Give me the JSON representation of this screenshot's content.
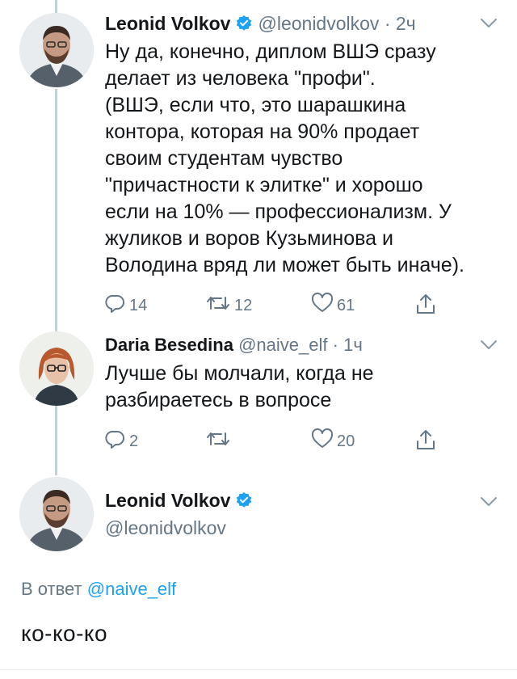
{
  "colors": {
    "accent": "#1da1f2",
    "muted": "#657786",
    "text": "#14171a",
    "thread_line": "#c4cfd6"
  },
  "tweets": [
    {
      "name": "Leonid Volkov",
      "verified": true,
      "handle": "@leonidvolkov",
      "separator": "·",
      "time": "2ч",
      "text_lines": [
        "Ну да, конечно, диплом ВШЭ сразу",
        "делает из человека \"профи\".",
        "(ВШЭ, если что, это шарашкина",
        "контора, которая на 90% продает",
        "своим студентам чувство",
        "\"причастности к элитке\" и хорошо",
        "если на 10% — профессионализм. У",
        "жуликов и воров Кузьминова и",
        "Володина вряд ли может быть иначе)."
      ],
      "replies": "14",
      "retweets": "12",
      "likes": "61"
    },
    {
      "name": "Daria Besedina",
      "verified": false,
      "handle": "@naive_elf",
      "separator": "·",
      "time": "1ч",
      "text_lines": [
        "Лучше бы молчали, когда не",
        "разбираетесь в вопросе"
      ],
      "replies": "2",
      "retweets": "",
      "likes": "20"
    }
  ],
  "main_tweet": {
    "name": "Leonid Volkov",
    "verified": true,
    "handle": "@leonidvolkov",
    "reply_prefix": "В ответ",
    "reply_mention": "@naive_elf",
    "text": "ко-ко-ко"
  },
  "icons": {
    "verified": "verified-badge-icon",
    "caret": "chevron-down-icon",
    "reply": "reply-icon",
    "retweet": "retweet-icon",
    "like": "heart-icon",
    "share": "share-icon"
  }
}
